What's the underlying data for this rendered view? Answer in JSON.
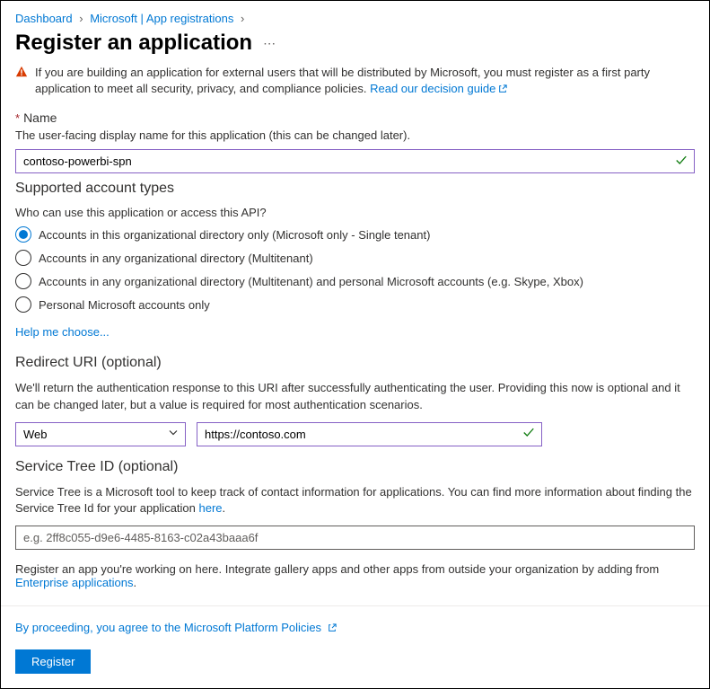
{
  "breadcrumb": {
    "items": [
      "Dashboard",
      "Microsoft | App registrations"
    ]
  },
  "title": "Register an application",
  "banner": {
    "text": "If you are building an application for external users that will be distributed by Microsoft, you must register as a first party application to meet all security, privacy, and compliance policies. ",
    "link": "Read our decision guide"
  },
  "name": {
    "label": "Name",
    "helper": "The user-facing display name for this application (this can be changed later).",
    "value": "contoso-powerbi-spn"
  },
  "accountTypes": {
    "heading": "Supported account types",
    "question": "Who can use this application or access this API?",
    "options": [
      "Accounts in this organizational directory only (Microsoft only - Single tenant)",
      "Accounts in any organizational directory (Multitenant)",
      "Accounts in any organizational directory (Multitenant) and personal Microsoft accounts (e.g. Skype, Xbox)",
      "Personal Microsoft accounts only"
    ],
    "selected": 0,
    "helpLink": "Help me choose..."
  },
  "redirect": {
    "heading": "Redirect URI (optional)",
    "desc": "We'll return the authentication response to this URI after successfully authenticating the user. Providing this now is optional and it can be changed later, but a value is required for most authentication scenarios.",
    "platform": "Web",
    "uri": "https://contoso.com"
  },
  "serviceTree": {
    "heading": "Service Tree ID (optional)",
    "desc_before": "Service Tree is a Microsoft tool to keep track of contact information for applications. You can find more information about finding the Service Tree Id for your application ",
    "desc_link": "here",
    "placeholder": "e.g. 2ff8c055-d9e6-4485-8163-c02a43baaa6f"
  },
  "footerNote": {
    "text": "Register an app you're working on here. Integrate gallery apps and other apps from outside your organization by adding from ",
    "link": "Enterprise applications"
  },
  "policy": "By proceeding, you agree to the Microsoft Platform Policies",
  "registerBtn": "Register"
}
